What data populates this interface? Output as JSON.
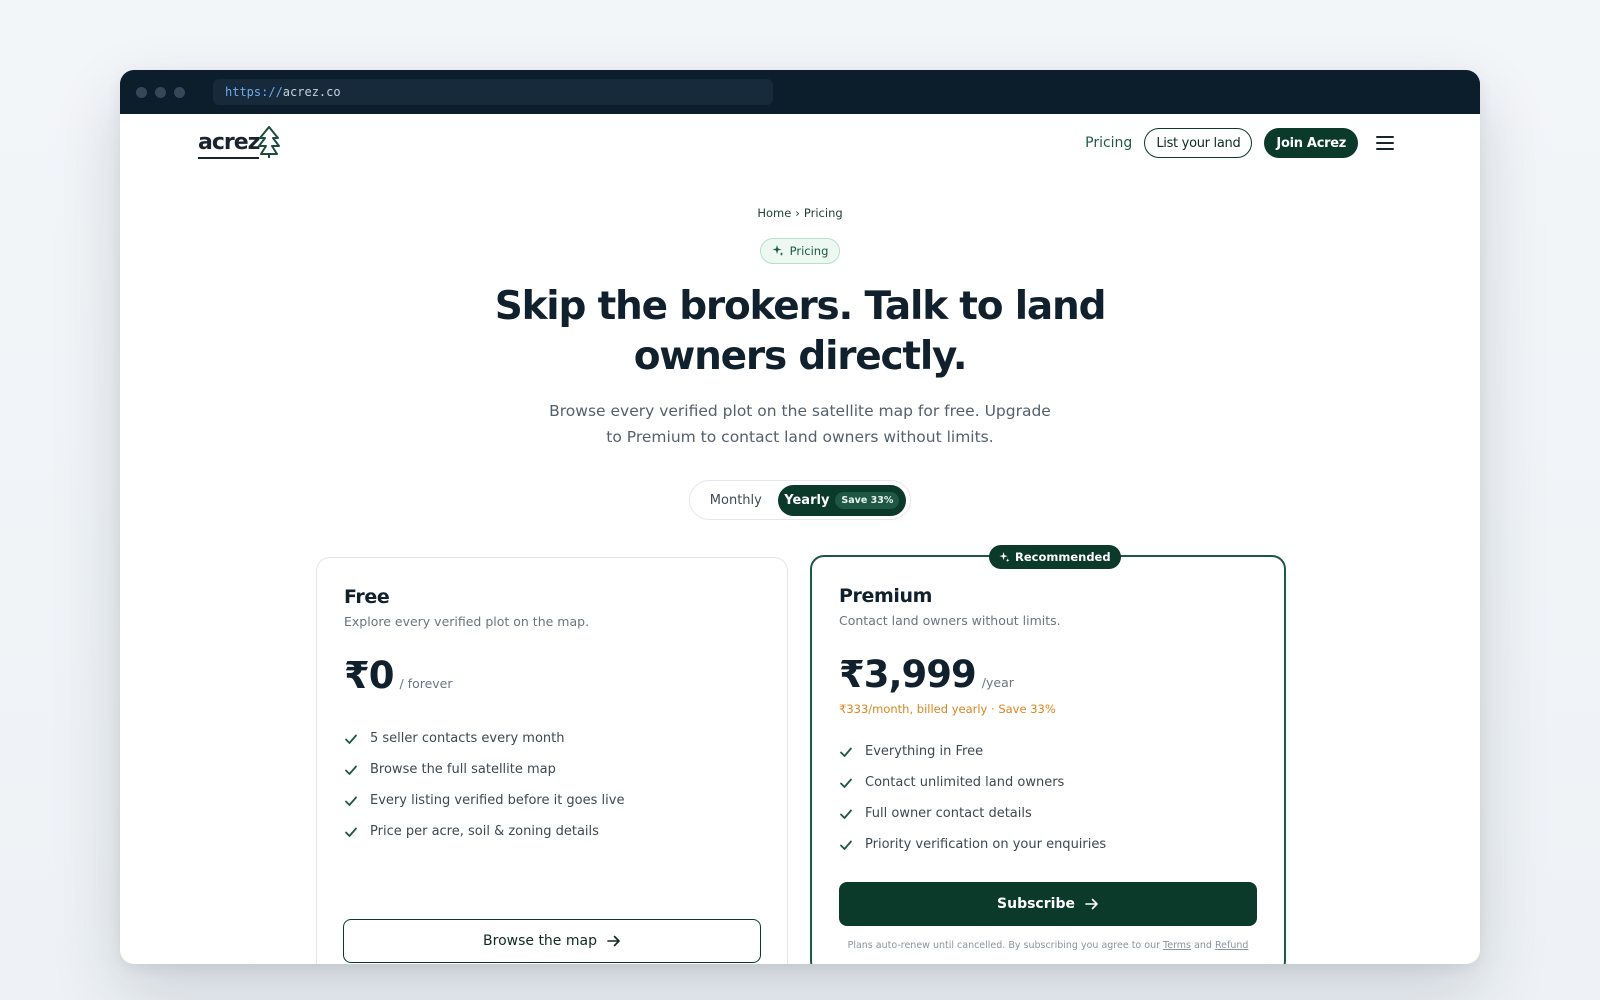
{
  "browser": {
    "url_scheme": "https://",
    "url_host": "acrez.co"
  },
  "nav": {
    "logo_text": "acrez",
    "pricing_link": "Pricing",
    "list_land_button": "List your land",
    "join_button": "Join Acrez"
  },
  "hero": {
    "breadcrumb_home": "Home",
    "breadcrumb_separator": "›",
    "breadcrumb_current": "Pricing",
    "badge_label": "Pricing",
    "headline": "Skip the brokers. Talk to land owners directly.",
    "subtext": "Browse every verified plot on the satellite map for free. Upgrade to Premium to contact land owners without limits."
  },
  "billing_toggle": {
    "monthly_label": "Monthly",
    "yearly_label": "Yearly",
    "save_chip": "Save 33%",
    "selected": "Yearly"
  },
  "plans": {
    "free": {
      "name": "Free",
      "description": "Explore every verified plot on the map.",
      "price": "₹0",
      "price_unit": "/ forever",
      "features": [
        "5 seller contacts every month",
        "Browse the full satellite map",
        "Every listing verified before it goes live",
        "Price per acre, soil & zoning details"
      ],
      "cta": "Browse the map"
    },
    "premium": {
      "badge": "Recommended",
      "name": "Premium",
      "description": "Contact land owners without limits.",
      "price": "₹3,999",
      "price_unit": "/year",
      "billing_note": "₹333/month, billed yearly · Save 33%",
      "features": [
        "Everything in Free",
        "Contact unlimited land owners",
        "Full owner contact details",
        "Priority verification on your enquiries"
      ],
      "cta": "Subscribe",
      "legal_prefix": "Plans auto-renew until cancelled. By subscribing you agree to our",
      "legal_terms": "Terms",
      "legal_and": "and",
      "legal_refund": "Refund"
    }
  },
  "colors": {
    "brand_dark": "#0b3a2a",
    "accent_orange": "#d9861f",
    "badge_bg": "#ecf8f1"
  }
}
